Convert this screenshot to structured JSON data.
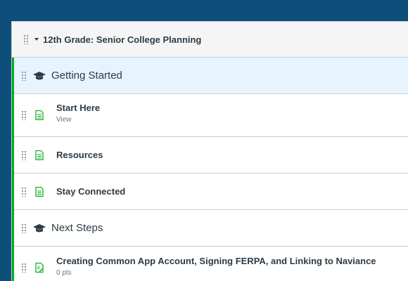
{
  "module": {
    "title": "12th Grade: Senior College Planning"
  },
  "items": [
    {
      "type": "subheader",
      "label": "Getting Started",
      "icon": "graduation-cap-icon",
      "active": true
    },
    {
      "type": "page",
      "label": "Start Here",
      "meta": "View",
      "icon": "page-icon"
    },
    {
      "type": "page",
      "label": "Resources",
      "icon": "page-icon"
    },
    {
      "type": "page",
      "label": "Stay Connected",
      "icon": "page-icon"
    },
    {
      "type": "subheader",
      "label": "Next Steps",
      "icon": "graduation-cap-icon"
    },
    {
      "type": "assignment",
      "label": "Creating Common App Account, Signing FERPA, and Linking to Naviance",
      "meta": "0 pts",
      "icon": "assignment-icon"
    }
  ],
  "colors": {
    "background": "#0d4f7a",
    "module_accent": "#00ac18",
    "page_icon": "#00ac18",
    "active_row": "#e8f4fd"
  }
}
